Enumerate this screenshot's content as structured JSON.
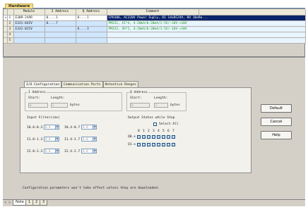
{
  "header": {
    "tab_label": "Hardware"
  },
  "grid": {
    "columns": [
      "",
      "Module",
      "I Address",
      "Q Address",
      "Comment"
    ],
    "rows": [
      {
        "marker": "▸",
        "num": "1",
        "module": "E30R-24AR",
        "iaddr": "0....1",
        "qaddr": "0....1",
        "comment": "CPU306, AC220V Power Suply, DI 14xDC24V, DO 10xRe..."
      },
      {
        "marker": "",
        "num": "2",
        "module": "E331-04IV",
        "iaddr": "0....7",
        "qaddr": "",
        "comment": "PM331, AI*4, 4-20mA/0-20mA/1-5V/-10V-+10V"
      },
      {
        "marker": "",
        "num": "3",
        "module": "E332-02IV",
        "iaddr": "",
        "qaddr": "0....3",
        "comment": "PM332, AO*2, 4-20mA/0-20mA/1-5V/-10V-+10V"
      },
      {
        "marker": "",
        "num": "4",
        "module": "",
        "iaddr": "",
        "qaddr": "",
        "comment": ""
      },
      {
        "marker": "",
        "num": "5",
        "module": "",
        "iaddr": "",
        "qaddr": "",
        "comment": ""
      }
    ]
  },
  "panel": {
    "tabs": [
      "I/O Configuration",
      "Communication Ports",
      "Retentive Ranges"
    ],
    "i_address": {
      "title": "I Address",
      "start_label": "Start:",
      "length_label": "Length:",
      "start_value": "0",
      "length_value": "2",
      "unit": "bytes"
    },
    "input_filters": {
      "title": "Input Filters(ms)",
      "items": [
        {
          "label": "I0.0-0.3",
          "value": "8.0"
        },
        {
          "label": "I0.4-0.7",
          "value": "8.0"
        },
        {
          "label": "I1.0-1.3",
          "value": "8.0"
        },
        {
          "label": "I1.4-1.7",
          "value": "8.0"
        },
        {
          "label": "I2.0-2.3",
          "value": "8.0"
        },
        {
          "label": "I2.4-2.7",
          "value": "8.0"
        }
      ]
    },
    "q_address": {
      "title": "Q Address",
      "start_label": "Start:",
      "length_label": "Length:",
      "start_value": "0",
      "length_value": "2",
      "unit": "bytes"
    },
    "output_states": {
      "title": "Output States while Stop",
      "select_all": "Select All",
      "bits": [
        "0",
        "1",
        "2",
        "3",
        "4",
        "5",
        "6",
        "7"
      ],
      "rows": [
        "Q0.x",
        "Q1.x"
      ]
    }
  },
  "buttons": {
    "default": "Default",
    "cancel": "Cancel",
    "help": "Help"
  },
  "hint": "Configuration parameters won't take effect unless they are downloaded.",
  "sheets": {
    "nav": "< > \\",
    "tabs": [
      "Note",
      "1",
      "2",
      "3"
    ]
  }
}
